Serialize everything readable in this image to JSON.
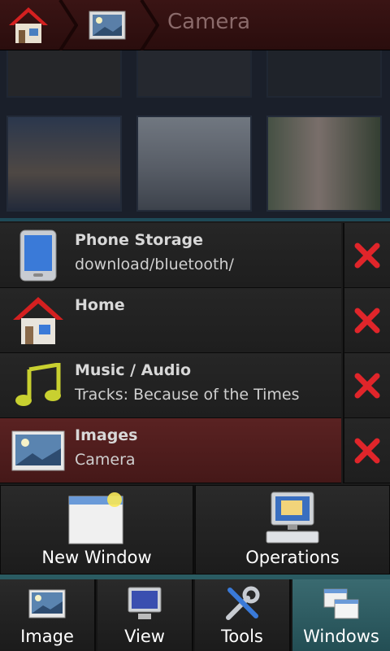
{
  "breadcrumb": {
    "title": "Camera",
    "home_icon": "home-icon",
    "images_icon": "image-folder-icon"
  },
  "windows": [
    {
      "title": "Phone Storage",
      "subtitle": "download/bluetooth/",
      "icon": "phone-storage-icon",
      "active": false
    },
    {
      "title": "Home",
      "subtitle": "",
      "icon": "home-icon",
      "active": false
    },
    {
      "title": "Music / Audio",
      "subtitle": "Tracks: Because of the Times",
      "icon": "music-note-icon",
      "active": false
    },
    {
      "title": "Images",
      "subtitle": "Camera",
      "icon": "image-icon",
      "active": true
    }
  ],
  "actions": {
    "new_window": "New Window",
    "operations": "Operations"
  },
  "tabs": [
    {
      "label": "Image",
      "icon": "image-icon",
      "selected": false
    },
    {
      "label": "View",
      "icon": "monitor-icon",
      "selected": false
    },
    {
      "label": "Tools",
      "icon": "tools-icon",
      "selected": false
    },
    {
      "label": "Windows",
      "icon": "windows-icon",
      "selected": true
    }
  ],
  "colors": {
    "active_row": "#5a2222",
    "close_x": "#e0252a",
    "selected_tab": "#3a6a70"
  }
}
